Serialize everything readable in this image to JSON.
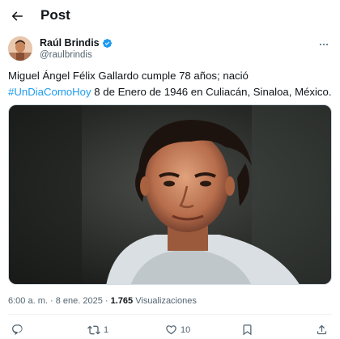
{
  "header": {
    "title": "Post",
    "back_icon": "arrow-left-icon"
  },
  "author": {
    "name": "Raúl Brindis",
    "handle": "@raulbrindis",
    "verified_icon": "verified-badge-icon",
    "verified_color": "#1d9bf0"
  },
  "tweet": {
    "text_before": "Miguel Ángel Félix Gallardo cumple 78 años; nació ",
    "hashtag": "#UnDiaComoHoy",
    "text_after": " 8 de Enero de 1946 en Culiacán, Sinaloa, México."
  },
  "meta": {
    "time": "6:00 a. m.",
    "separator": "·",
    "date": "8 ene. 2025",
    "views_count": "1.765",
    "views_label": "Visualizaciones"
  },
  "actions": {
    "reply_icon": "reply-icon",
    "retweet_icon": "retweet-icon",
    "retweet_count": "1",
    "like_icon": "heart-icon",
    "like_count": "10",
    "bookmark_icon": "bookmark-icon",
    "share_icon": "share-icon"
  },
  "colors": {
    "accent": "#1d9bf0",
    "text": "#0f1419",
    "secondary": "#536471"
  }
}
